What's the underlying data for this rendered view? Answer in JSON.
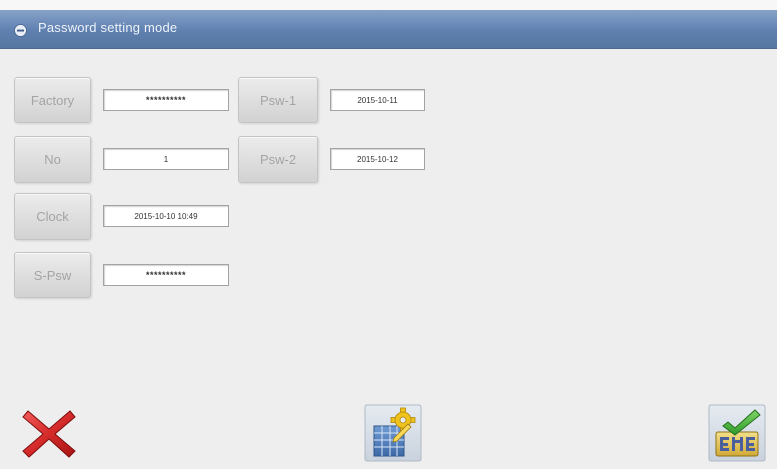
{
  "window": {
    "title": "Password setting mode",
    "title_icon": "minus-circle-icon"
  },
  "form": {
    "factory": {
      "label": "Factory",
      "value": "**********"
    },
    "no": {
      "label": "No",
      "value": "1"
    },
    "clock": {
      "label": "Clock",
      "value": "2015-10-10 10:49"
    },
    "s_psw": {
      "label": "S-Psw",
      "value": "**********"
    },
    "psw_1": {
      "label": "Psw-1",
      "value": "2015-10-11"
    },
    "psw_2": {
      "label": "Psw-2",
      "value": "2015-10-12"
    }
  },
  "toolbar": {
    "cancel": {
      "icon": "close-icon"
    },
    "settings": {
      "icon": "settings-document-icon"
    },
    "confirm": {
      "icon": "confirm-check-icon"
    }
  },
  "colors": {
    "title_bar": "#5f80b0",
    "background": "#eeeeee",
    "button_text": "#a4a4a4",
    "cancel_red": "#d42a2a",
    "confirm_green": "#3fae3a"
  }
}
